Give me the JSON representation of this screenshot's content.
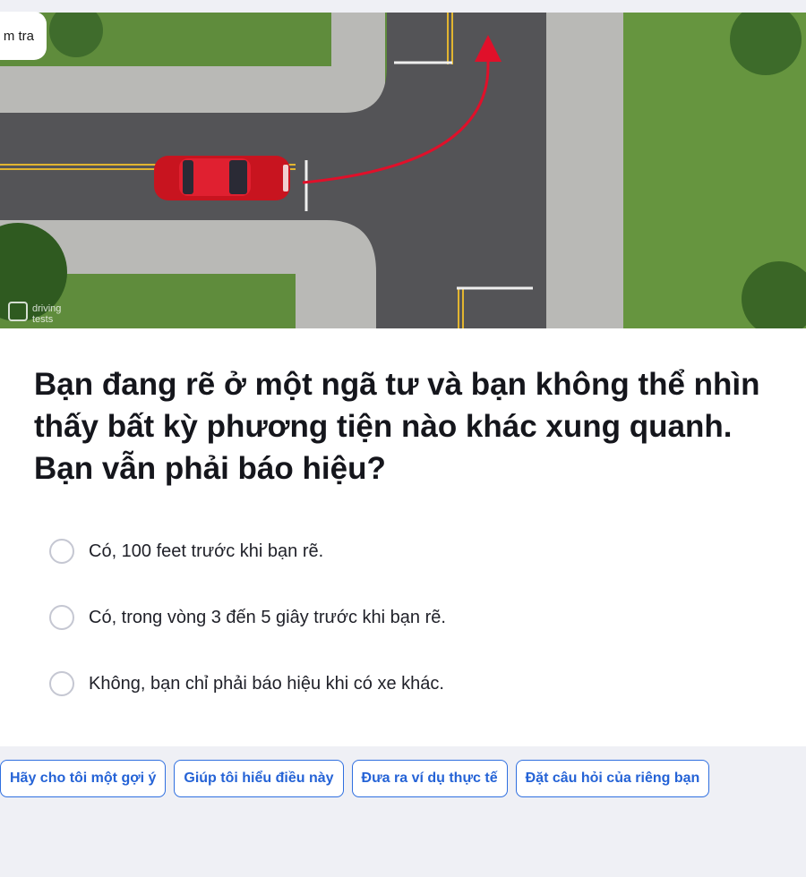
{
  "header": {
    "tag_label": "m tra"
  },
  "image": {
    "watermark_line1": "driving",
    "watermark_line2": "tests"
  },
  "question": {
    "text": "Bạn đang rẽ ở một ngã tư và bạn không thể nhìn thấy bất kỳ phương tiện nào khác xung quanh. Bạn vẫn phải báo hiệu?"
  },
  "options": [
    {
      "label": "Có, 100 feet trước khi bạn rẽ."
    },
    {
      "label": "Có, trong vòng 3 đến 5 giây trước khi bạn rẽ."
    },
    {
      "label": "Không, bạn chỉ phải báo hiệu khi có xe khác."
    }
  ],
  "chips": [
    {
      "label": "Hãy cho tôi một gợi ý"
    },
    {
      "label": "Giúp tôi hiểu điều này"
    },
    {
      "label": "Đưa ra ví dụ thực tế"
    },
    {
      "label": "Đặt câu hỏi của riêng bạn"
    }
  ],
  "colors": {
    "accent": "#2563d6",
    "car": "#d11a2a",
    "arrow": "#e0102a",
    "grass": "#5c8a3a",
    "asphalt": "#555558"
  }
}
